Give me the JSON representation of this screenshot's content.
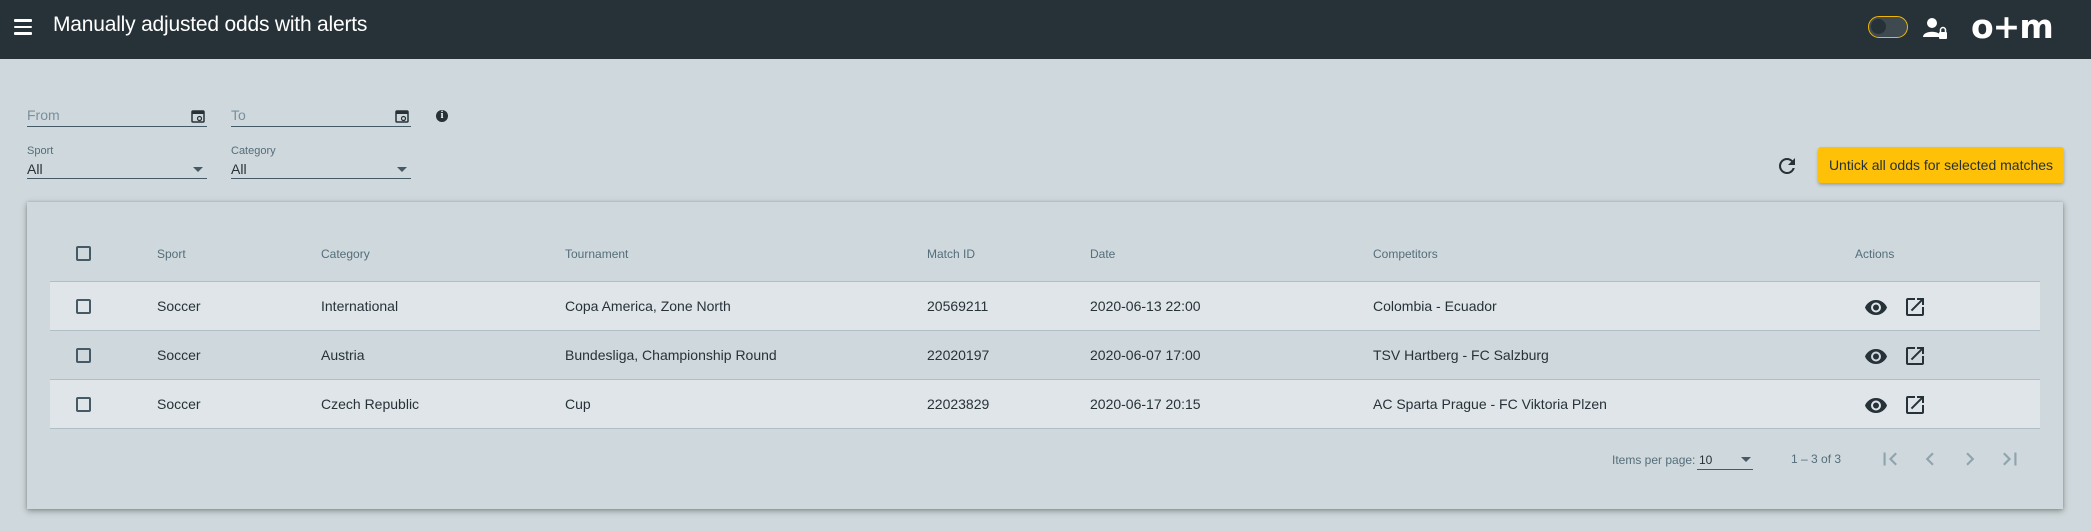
{
  "header": {
    "title": "Manually adjusted odds with alerts",
    "logo": "o+m"
  },
  "filters": {
    "from_placeholder": "From",
    "to_placeholder": "To",
    "sport": {
      "label": "Sport",
      "value": "All"
    },
    "category": {
      "label": "Category",
      "value": "All"
    }
  },
  "actions": {
    "untick_label": "Untick all odds for selected matches"
  },
  "table": {
    "columns": {
      "sport": "Sport",
      "category": "Category",
      "tournament": "Tournament",
      "match_id": "Match ID",
      "date": "Date",
      "competitors": "Competitors",
      "actions": "Actions"
    },
    "rows": [
      {
        "sport": "Soccer",
        "category": "International",
        "tournament": "Copa America, Zone North",
        "match_id": "20569211",
        "date": "2020-06-13 22:00",
        "competitors": "Colombia - Ecuador"
      },
      {
        "sport": "Soccer",
        "category": "Austria",
        "tournament": "Bundesliga, Championship Round",
        "match_id": "22020197",
        "date": "2020-06-07 17:00",
        "competitors": "TSV Hartberg - FC Salzburg"
      },
      {
        "sport": "Soccer",
        "category": "Czech Republic",
        "tournament": "Cup",
        "match_id": "22023829",
        "date": "2020-06-17 20:15",
        "competitors": "AC Sparta Prague - FC Viktoria Plzen"
      }
    ]
  },
  "paginator": {
    "items_per_page_label": "Items per page:",
    "items_per_page_value": "10",
    "range_label": "1 – 3 of 3"
  },
  "colors": {
    "topbar": "#263238",
    "background": "#cfd8dc",
    "accent": "#ffc107",
    "row_alt": "#dfe5e8"
  }
}
